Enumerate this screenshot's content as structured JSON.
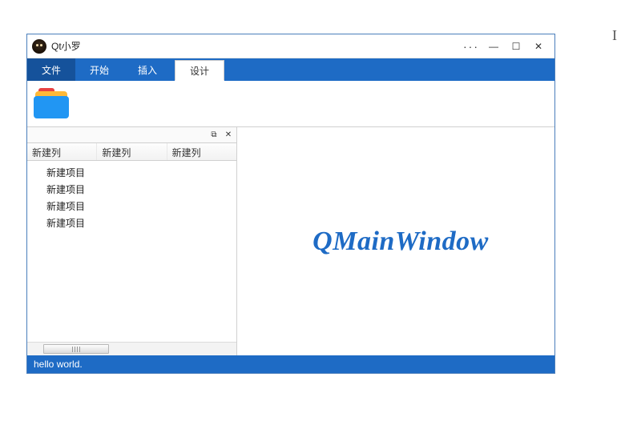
{
  "window": {
    "title": "Qt小罗"
  },
  "menu": {
    "items": [
      "文件",
      "开始",
      "插入",
      "设计"
    ],
    "active_index": 0,
    "design_index": 3
  },
  "dock": {
    "columns": [
      "新建列",
      "新建列",
      "新建列"
    ],
    "items": [
      "新建项目",
      "新建项目",
      "新建项目",
      "新建项目"
    ]
  },
  "central": {
    "text": "QMainWindow"
  },
  "statusbar": {
    "text": "hello world."
  },
  "controls": {
    "more": "···",
    "min": "—",
    "max": "☐",
    "close": "✕",
    "float": "⧉",
    "dock_close": "✕"
  },
  "cursor": "I"
}
